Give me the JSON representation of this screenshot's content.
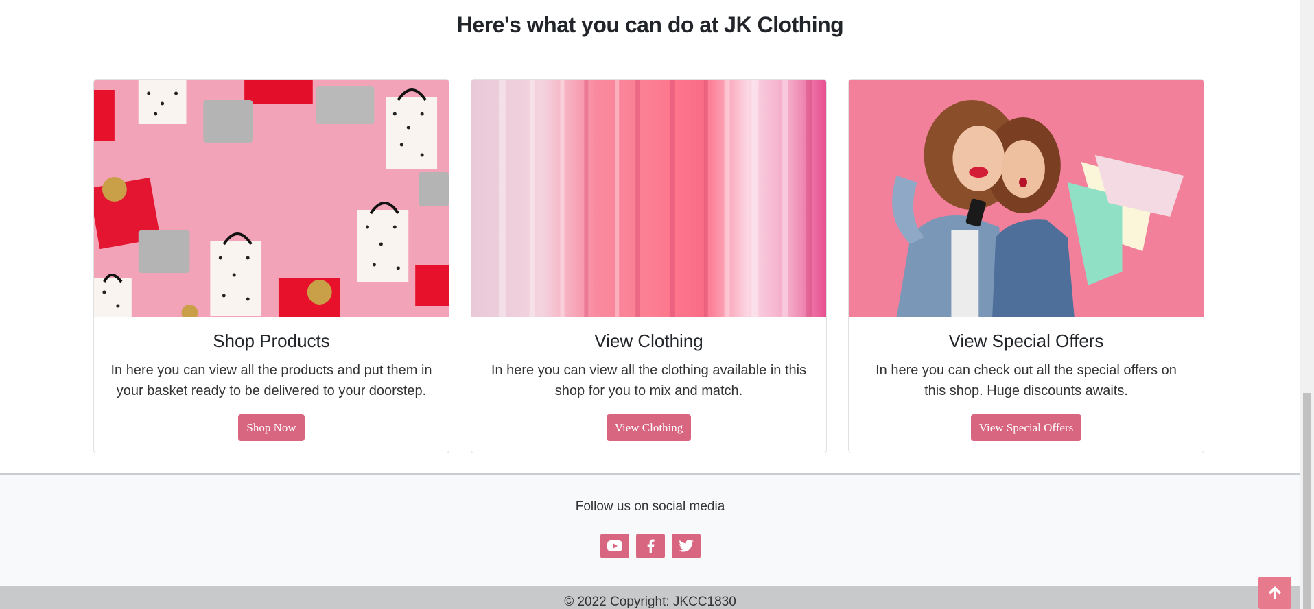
{
  "section": {
    "title": "Here's what you can do at JK Clothing"
  },
  "cards": [
    {
      "title": "Shop Products",
      "text": "In here you can view all the products and put them in your basket ready to be delivered to your doorstep.",
      "button": "Shop Now",
      "image_icon": "gift-bags-image"
    },
    {
      "title": "View Clothing",
      "text": "In here you can view all the clothing available in this shop for you to mix and match.",
      "button": "View Clothing",
      "image_icon": "clothing-rack-image"
    },
    {
      "title": "View Special Offers",
      "text": "In here you can check out all the special offers on this shop. Huge discounts awaits.",
      "button": "View Special Offers",
      "image_icon": "shopping-friends-image"
    }
  ],
  "footer": {
    "follow_text": "Follow us on social media",
    "socials": [
      "youtube-icon",
      "facebook-icon",
      "twitter-icon"
    ],
    "copyright": "© 2022 Copyright: JKCC1830"
  },
  "colors": {
    "accent": "#d96680",
    "back_to_top": "#e87a8e",
    "footer_bg": "#f8f9fa",
    "copyright_bg": "#c8c9cb"
  }
}
